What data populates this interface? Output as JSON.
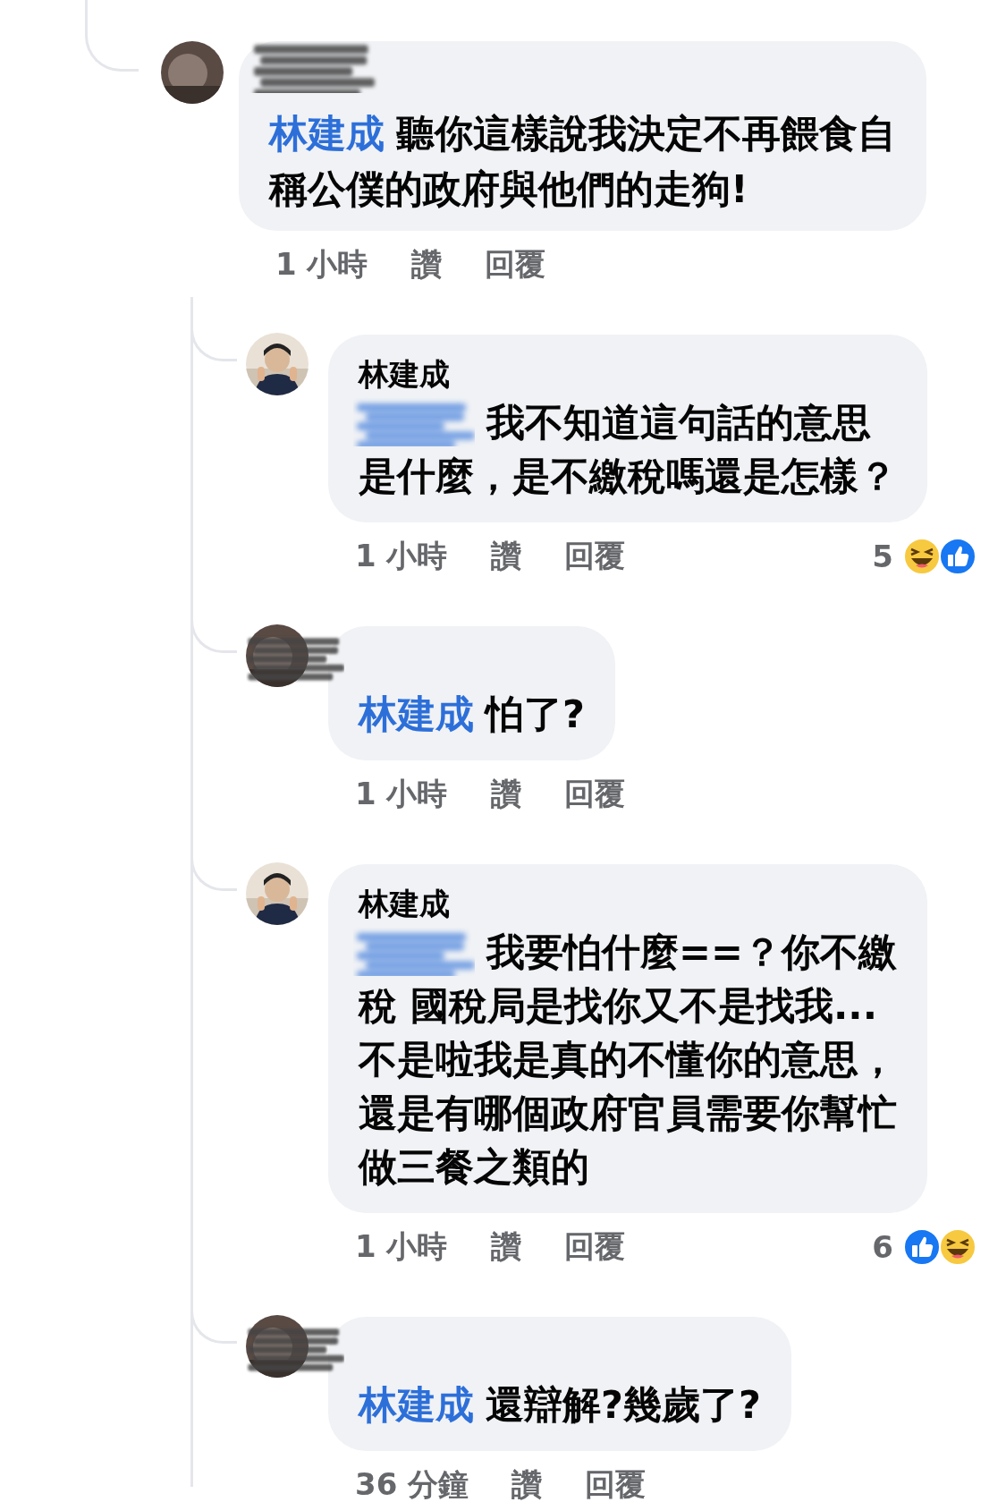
{
  "thread": {
    "comment": {
      "avatar": {
        "kind": "redacted"
      },
      "scribble": true,
      "mention": {
        "kind": "name",
        "text": "林建成"
      },
      "lines": [
        "聽你這樣說我決定不再餵食自",
        "稱公僕的政府與他們的走狗!"
      ],
      "meta": {
        "time": "1 小時",
        "like": "讚",
        "reply": "回覆"
      }
    },
    "children": [
      {
        "scribble": false,
        "author": {
          "kind": "name",
          "text": "林建成"
        },
        "mention": {
          "kind": "redacted"
        },
        "lines": [
          "我不知道這句話的意思",
          "是什麼，是不繳稅嗎還是怎樣？"
        ],
        "meta": {
          "time": "1 小時",
          "like": "讚",
          "reply": "回覆",
          "reaction_count": "5",
          "reactions": [
            {
              "kind": "haha"
            },
            {
              "kind": "like"
            }
          ]
        }
      },
      {
        "avatar": {
          "kind": "redacted"
        },
        "scribble": true,
        "author": {
          "kind": "hidden"
        },
        "mention": {
          "kind": "name",
          "text": "林建成"
        },
        "lines": [
          "怕了?"
        ],
        "meta": {
          "time": "1 小時",
          "like": "讚",
          "reply": "回覆"
        }
      },
      {
        "scribble": false,
        "author": {
          "kind": "name",
          "text": "林建成"
        },
        "mention": {
          "kind": "redacted"
        },
        "lines": [
          "我要怕什麼==？你不繳",
          "稅 國稅局是找你又不是找我...",
          "不是啦我是真的不懂你的意思，",
          "還是有哪個政府官員需要你幫忙",
          "做三餐之類的"
        ],
        "meta": {
          "time": "1 小時",
          "like": "讚",
          "reply": "回覆",
          "reaction_count": "6",
          "reactions": [
            {
              "kind": "like"
            },
            {
              "kind": "haha"
            }
          ]
        }
      },
      {
        "avatar": {
          "kind": "redacted"
        },
        "scribble": true,
        "author": {
          "kind": "hidden"
        },
        "mention": {
          "kind": "name",
          "text": "林建成"
        },
        "lines": [
          "還辯解?幾歲了?"
        ],
        "meta": {
          "time": "36 分鐘",
          "like": "讚",
          "reply": "回覆"
        }
      }
    ]
  }
}
